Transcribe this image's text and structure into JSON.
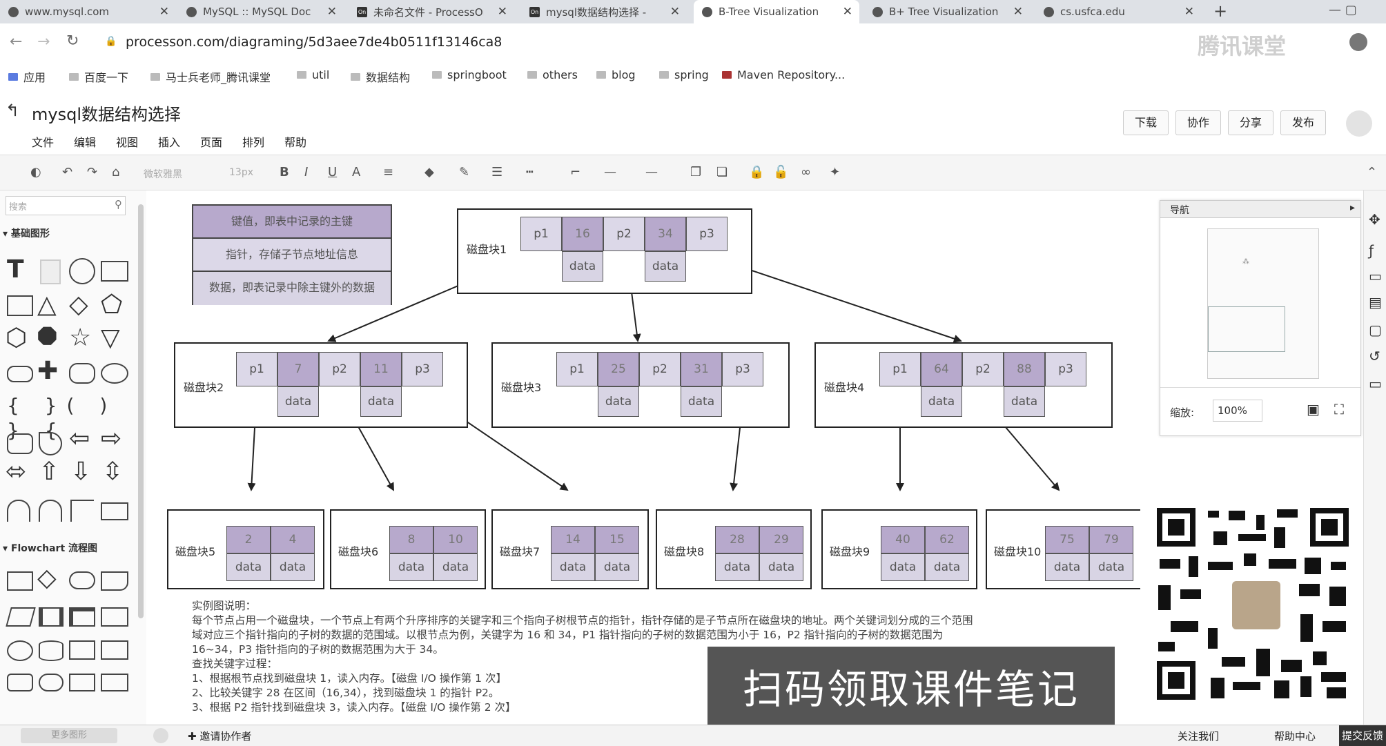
{
  "browser": {
    "tabs": [
      {
        "title": "www.mysql.com"
      },
      {
        "title": "MySQL :: MySQL Doc"
      },
      {
        "title": "未命名文件 - ProcessOn"
      },
      {
        "title": "mysql数据结构选择 -"
      },
      {
        "title": "B-Tree Visualization"
      },
      {
        "title": "B+ Tree Visualization"
      },
      {
        "title": "cs.usfca.edu"
      }
    ],
    "new_tab": "+",
    "url": "processon.com/diagraming/5d3aee7de4b0511f13146ca8",
    "bookmarks": [
      "应用",
      "百度一下",
      "马士兵老师_腾讯课堂",
      "util",
      "数据结构",
      "springboot",
      "others",
      "blog",
      "spring",
      "Maven Repository..."
    ],
    "watermark": "腾讯课堂"
  },
  "app": {
    "title": "mysql数据结构选择",
    "menu": [
      "文件",
      "编辑",
      "视图",
      "插入",
      "页面",
      "排列",
      "帮助"
    ],
    "header_buttons": [
      "下载",
      "协作",
      "分享",
      "发布"
    ],
    "toolbar": {
      "font": "微软雅黑",
      "size": "13px"
    },
    "search_placeholder": "搜索",
    "sections": {
      "basic": "基础图形",
      "flowchart": "Flowchart 流程图"
    }
  },
  "diagram": {
    "legend": [
      "键值，即表中记录的主键",
      "指针，存储子节点地址信息",
      "数据，即表记录中除主键外的数据"
    ],
    "labels": {
      "p1": "p1",
      "p2": "p2",
      "p3": "p3",
      "data": "data"
    },
    "root": {
      "label": "磁盘块1",
      "keys": [
        "16",
        "34"
      ]
    },
    "level2": [
      {
        "label": "磁盘块2",
        "keys": [
          "7",
          "11"
        ]
      },
      {
        "label": "磁盘块3",
        "keys": [
          "25",
          "31"
        ]
      },
      {
        "label": "磁盘块4",
        "keys": [
          "64",
          "88"
        ]
      }
    ],
    "leaves": [
      {
        "label": "磁盘块5",
        "keys": [
          "2",
          "4"
        ]
      },
      {
        "label": "磁盘块6",
        "keys": [
          "8",
          "10"
        ]
      },
      {
        "label": "磁盘块7",
        "keys": [
          "14",
          "15"
        ]
      },
      {
        "label": "磁盘块8",
        "keys": [
          "28",
          "29"
        ]
      },
      {
        "label": "磁盘块9",
        "keys": [
          "40",
          "62"
        ]
      },
      {
        "label": "磁盘块10",
        "keys": [
          "75",
          "79"
        ]
      }
    ],
    "description": [
      "实例图说明：",
      "每个节点占用一个磁盘块，一个节点上有两个升序排序的关键字和三个指向子树根节点的指针，指针存储的是子节点所在磁盘块的地址。两个关键词划分成的三个范围",
      "域对应三个指针指向的子树的数据的范围域。以根节点为例，关键字为 16 和 34，P1 指针指向的子树的数据范围为小于 16，P2 指针指向的子树的数据范围为",
      "16~34，P3 指针指向的子树的数据范围为大于 34。",
      "查找关键字过程：",
      "1、根据根节点找到磁盘块 1，读入内存。【磁盘 I/O 操作第 1 次】",
      "2、比较关键字 28 在区间（16,34），找到磁盘块 1 的指针 P2。",
      "3、根据 P2 指针找到磁盘块 3，读入内存。【磁盘 I/O 操作第 2 次】"
    ]
  },
  "nav": {
    "title": "导航",
    "zoom_label": "缩放:",
    "zoom": "100%"
  },
  "overlay": {
    "banner": "扫码领取课件笔记"
  },
  "footer": {
    "invite": "邀请协作者",
    "more_shapes": "更多图形",
    "follow": "关注我们",
    "help": "帮助中心",
    "feedback": "提交反馈"
  },
  "colors": {
    "pointer": "#dcd8e8",
    "key": "#b7a9cc",
    "data": "#d8d4e4"
  }
}
